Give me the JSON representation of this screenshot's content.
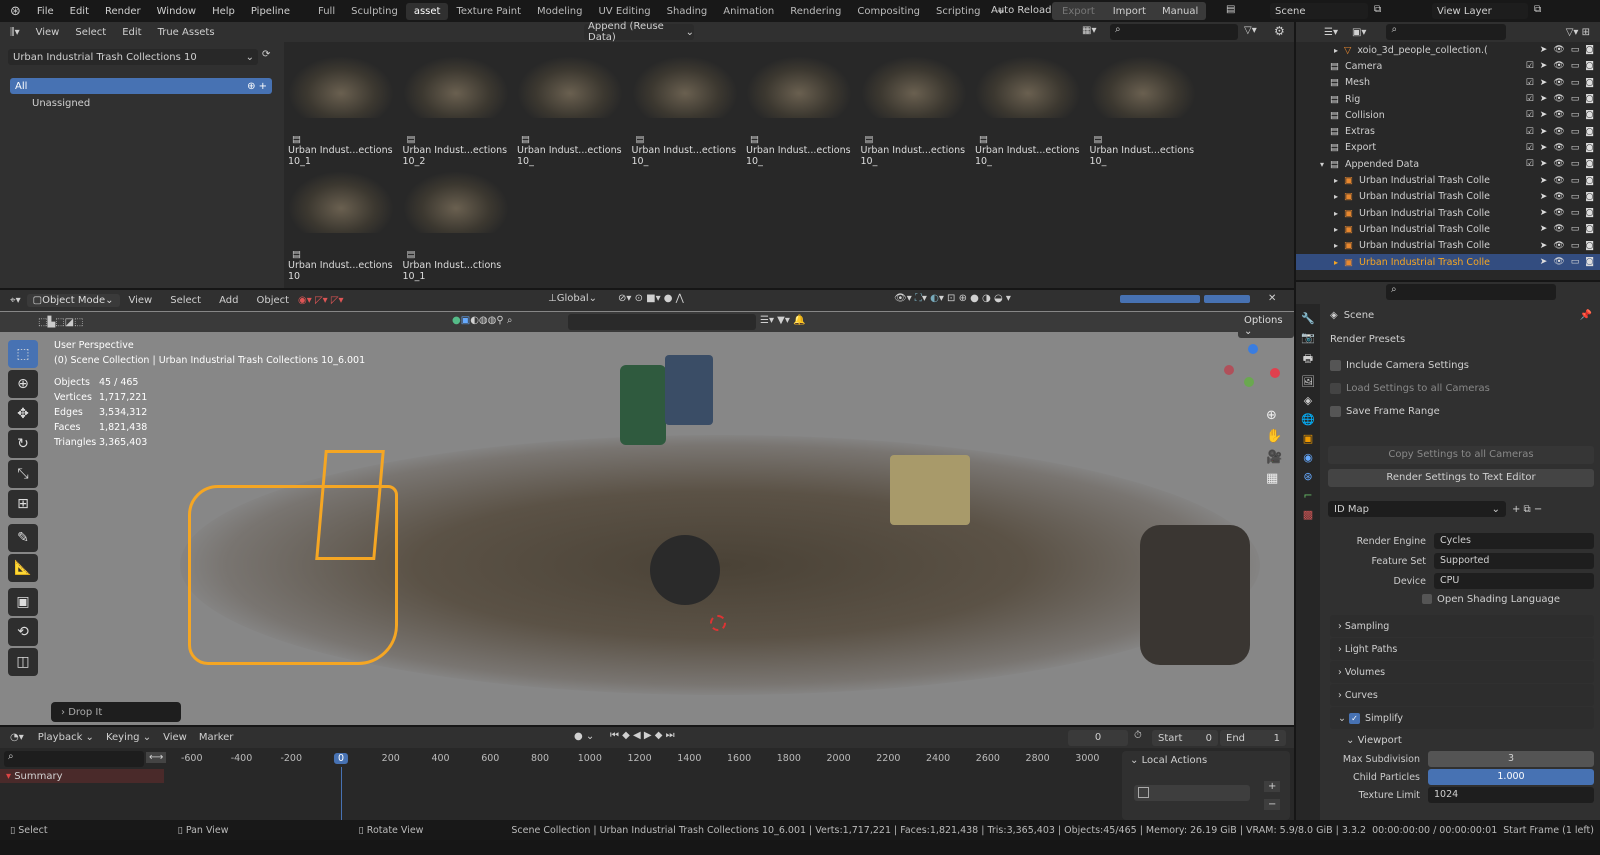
{
  "topbar": {
    "menus": [
      "File",
      "Edit",
      "Render",
      "Window",
      "Help",
      "Pipeline"
    ],
    "workspaces": [
      "Full",
      "Sculpting",
      "asset",
      "Texture Paint",
      "Modeling",
      "UV Editing",
      "Shading",
      "Animation",
      "Rendering",
      "Compositing",
      "Scripting"
    ],
    "active_workspace": "asset",
    "auto_reload": "Auto Reload",
    "export": "Export",
    "import": "Import",
    "manual": "Manual",
    "scene": "Scene",
    "view_layer": "View Layer"
  },
  "asset_browser": {
    "menus": [
      "View",
      "Select",
      "Edit",
      "True Assets"
    ],
    "import_mode": "Append (Reuse Data)",
    "library": "Urban Industrial Trash Collections 10",
    "catalogs": [
      "All",
      "Unassigned"
    ],
    "assets": [
      "Urban Indust...ections 10_1",
      "Urban Indust...ections 10_2",
      "Urban Indust...ections 10_",
      "Urban Indust...ections 10_",
      "Urban Indust...ections 10_",
      "Urban Indust...ections 10_",
      "Urban Indust...ections 10_",
      "Urban Indust...ections 10_",
      "Urban Indust...ections 10",
      "Urban Indust...ctions 10_1"
    ]
  },
  "outliner": {
    "items": [
      {
        "label": "xoio_3d_people_collection.(",
        "type": "object",
        "indent": 2
      },
      {
        "label": "Camera",
        "type": "collection",
        "indent": 1
      },
      {
        "label": "Mesh",
        "type": "collection",
        "indent": 1
      },
      {
        "label": "Rig",
        "type": "collection",
        "indent": 1
      },
      {
        "label": "Collision",
        "type": "collection",
        "indent": 1
      },
      {
        "label": "Extras",
        "type": "collection",
        "indent": 1
      },
      {
        "label": "Export",
        "type": "collection",
        "indent": 1
      },
      {
        "label": "Appended Data",
        "type": "collection",
        "indent": 1
      },
      {
        "label": "Urban Industrial Trash Colle",
        "type": "instance",
        "indent": 2
      },
      {
        "label": "Urban Industrial Trash Colle",
        "type": "instance",
        "indent": 2
      },
      {
        "label": "Urban Industrial Trash Colle",
        "type": "instance",
        "indent": 2
      },
      {
        "label": "Urban Industrial Trash Colle",
        "type": "instance",
        "indent": 2
      },
      {
        "label": "Urban Industrial Trash Colle",
        "type": "instance",
        "indent": 2
      },
      {
        "label": "Urban Industrial Trash Colle",
        "type": "instance",
        "indent": 2,
        "selected": true
      }
    ]
  },
  "viewport": {
    "mode": "Object Mode",
    "menus": [
      "View",
      "Select",
      "Add",
      "Object"
    ],
    "orientation": "Global",
    "options": "Options",
    "perspective": "User Perspective",
    "collection_info": "(0) Scene Collection | Urban Industrial Trash Collections 10_6.001",
    "stats": [
      {
        "label": "Objects",
        "value": "45 / 465"
      },
      {
        "label": "Vertices",
        "value": "1,717,221"
      },
      {
        "label": "Edges",
        "value": "3,534,312"
      },
      {
        "label": "Faces",
        "value": "1,821,438"
      },
      {
        "label": "Triangles",
        "value": "3,365,403"
      }
    ],
    "last_op": "Drop It"
  },
  "timeline": {
    "menus": [
      "Playback",
      "Keying",
      "View",
      "Marker"
    ],
    "current_frame": "0",
    "start_label": "Start",
    "start": "0",
    "end_label": "End",
    "end": "1",
    "ticks": [
      "-600",
      "-400",
      "-200",
      "0",
      "200",
      "400",
      "600",
      "800",
      "1000",
      "1200",
      "1400",
      "1600",
      "1800",
      "2000",
      "2200",
      "2400",
      "2600",
      "2800",
      "3000"
    ],
    "summary": "Summary",
    "local_actions": "Local Actions"
  },
  "properties": {
    "scene": "Scene",
    "render_presets": "Render Presets",
    "include_camera": "Include Camera Settings",
    "load_all": "Load Settings to all Cameras",
    "save_frame": "Save Frame Range",
    "copy_settings": "Copy Settings to all Cameras",
    "render_to_text": "Render Settings to Text Editor",
    "id_map": "ID Map",
    "render_engine_label": "Render Engine",
    "render_engine": "Cycles",
    "feature_set_label": "Feature Set",
    "feature_set": "Supported",
    "device_label": "Device",
    "device": "CPU",
    "osl": "Open Shading Language",
    "panels": [
      "Sampling",
      "Light Paths",
      "Volumes",
      "Curves"
    ],
    "simplify": "Simplify",
    "viewport": "Viewport",
    "max_subdiv_label": "Max Subdivision",
    "max_subdiv": "3",
    "child_particles_label": "Child Particles",
    "child_particles": "1.000",
    "texture_limit_label": "Texture Limit",
    "texture_limit": "1024"
  },
  "statusbar": {
    "select": "Select",
    "pan": "Pan View",
    "rotate": "Rotate View",
    "info": "Scene Collection | Urban Industrial Trash Collections 10_6.001 | Verts:1,717,221 | Faces:1,821,438 | Tris:3,365,403 | Objects:45/465 | Memory: 26.19 GiB | VRAM: 5.9/8.0 GiB | 3.3.2  00:00:00:00 / 00:00:00:01  Start Frame (1 left)"
  },
  "colors": {
    "accent": "#4772b3",
    "selection": "#f5a623"
  }
}
